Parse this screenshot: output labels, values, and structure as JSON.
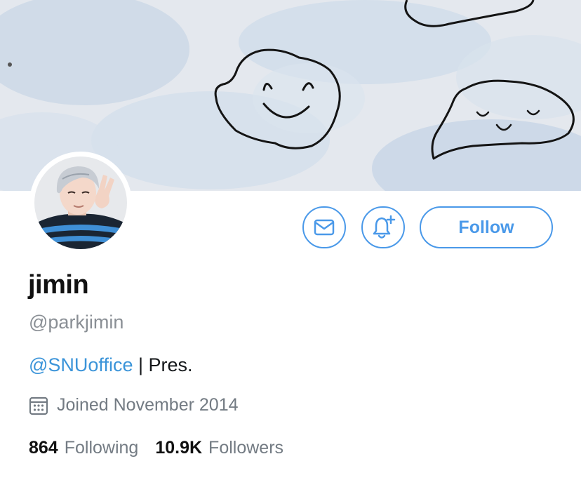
{
  "profile": {
    "display_name": "jimin",
    "handle": "@parkjimin",
    "bio": {
      "mention": "@SNUoffice",
      "text": " | Pres."
    },
    "joined": "Joined November 2014",
    "stats": {
      "following_count": "864",
      "following_label": "Following",
      "followers_count": "10.9K",
      "followers_label": "Followers"
    }
  },
  "actions": {
    "follow_label": "Follow"
  },
  "icons": {
    "message": "envelope-icon",
    "notify": "bell-plus-icon",
    "joined": "calendar-icon"
  },
  "colors": {
    "accent": "#4a99e9",
    "link": "#3b94d9",
    "secondary_text": "#737b83"
  }
}
